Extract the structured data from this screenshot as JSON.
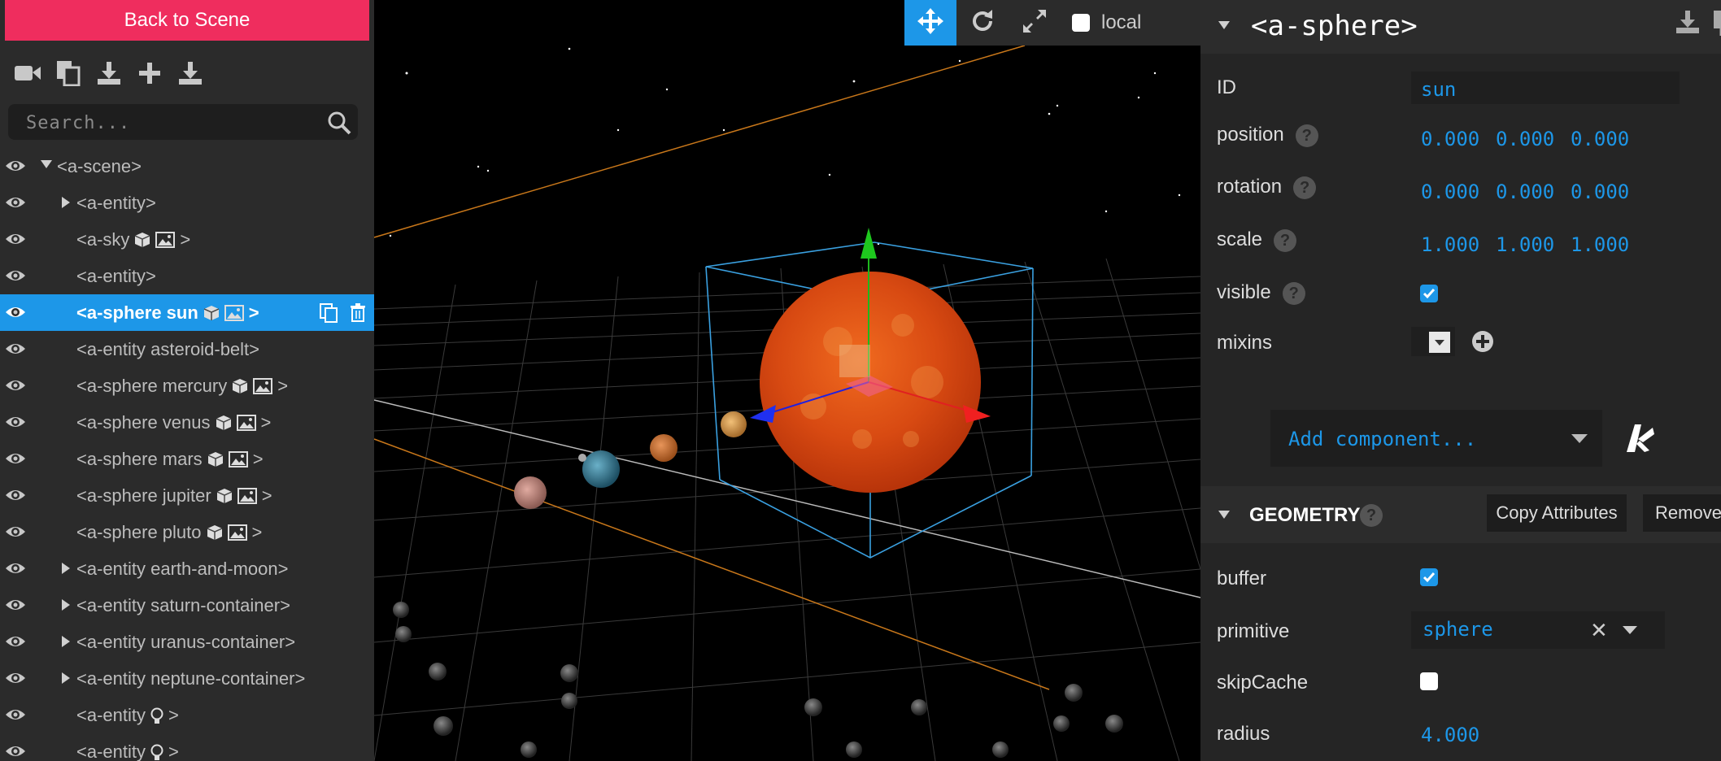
{
  "left_panel": {
    "back_button": "Back to Scene",
    "toolbar_icons": [
      "camera-icon",
      "copy-icon",
      "download-icon",
      "plus-icon",
      "export-icon"
    ],
    "search_placeholder": "Search...",
    "tree": [
      {
        "label": "<a-scene>",
        "expander": "open",
        "level": 0
      },
      {
        "label": "<a-entity>",
        "expander": "closed",
        "level": 1
      },
      {
        "label": "<a-sky",
        "extras": [
          "geometry-icon",
          "image-icon"
        ],
        "suffix": ">",
        "level": 1
      },
      {
        "label": "<a-entity>",
        "level": 1
      },
      {
        "label": "<a-sphere sun",
        "extras": [
          "geometry-icon",
          "image-icon"
        ],
        "suffix": ">",
        "level": 1,
        "selected": true
      },
      {
        "label": "<a-entity asteroid-belt>",
        "level": 1
      },
      {
        "label": "<a-sphere mercury",
        "extras": [
          "geometry-icon",
          "image-icon"
        ],
        "suffix": ">",
        "level": 1
      },
      {
        "label": "<a-sphere venus",
        "extras": [
          "geometry-icon",
          "image-icon"
        ],
        "suffix": ">",
        "level": 1
      },
      {
        "label": "<a-sphere mars",
        "extras": [
          "geometry-icon",
          "image-icon"
        ],
        "suffix": ">",
        "level": 1
      },
      {
        "label": "<a-sphere jupiter",
        "extras": [
          "geometry-icon",
          "image-icon"
        ],
        "suffix": ">",
        "level": 1
      },
      {
        "label": "<a-sphere pluto",
        "extras": [
          "geometry-icon",
          "image-icon"
        ],
        "suffix": ">",
        "level": 1
      },
      {
        "label": "<a-entity earth-and-moon>",
        "expander": "closed",
        "level": 1
      },
      {
        "label": "<a-entity saturn-container>",
        "expander": "closed",
        "level": 1
      },
      {
        "label": "<a-entity uranus-container>",
        "expander": "closed",
        "level": 1
      },
      {
        "label": "<a-entity neptune-container>",
        "expander": "closed",
        "level": 1
      },
      {
        "label": "<a-entity",
        "extras": [
          "light-icon"
        ],
        "suffix": ">",
        "level": 1
      },
      {
        "label": "<a-entity",
        "extras": [
          "light-icon"
        ],
        "suffix": ">",
        "level": 1
      }
    ]
  },
  "viewport_toolbar": {
    "tools": [
      "translate-icon",
      "rotate-icon",
      "scale-icon"
    ],
    "active_tool": "translate-icon",
    "local_label": "local",
    "local_checked": false
  },
  "inspector": {
    "entity_title": "<a-sphere>",
    "id_label": "ID",
    "id_value": "sun",
    "position_label": "position",
    "position": [
      "0.000",
      "0.000",
      "0.000"
    ],
    "rotation_label": "rotation",
    "rotation": [
      "0.000",
      "0.000",
      "0.000"
    ],
    "scale_label": "scale",
    "scale": [
      "1.000",
      "1.000",
      "1.000"
    ],
    "visible_label": "visible",
    "visible": true,
    "mixins_label": "mixins",
    "add_component": "Add component...",
    "geometry": {
      "title": "GEOMETRY",
      "copy_button": "Copy Attributes",
      "remove_button": "Remove",
      "buffer_label": "buffer",
      "buffer": true,
      "primitive_label": "primitive",
      "primitive": "sphere",
      "skipcache_label": "skipCache",
      "skipcache": false,
      "radius_label": "radius",
      "radius": "4.000"
    }
  },
  "colors": {
    "accent": "#1d97e8",
    "back_button": "#ef2d5e",
    "panel": "#2b2b2b"
  }
}
